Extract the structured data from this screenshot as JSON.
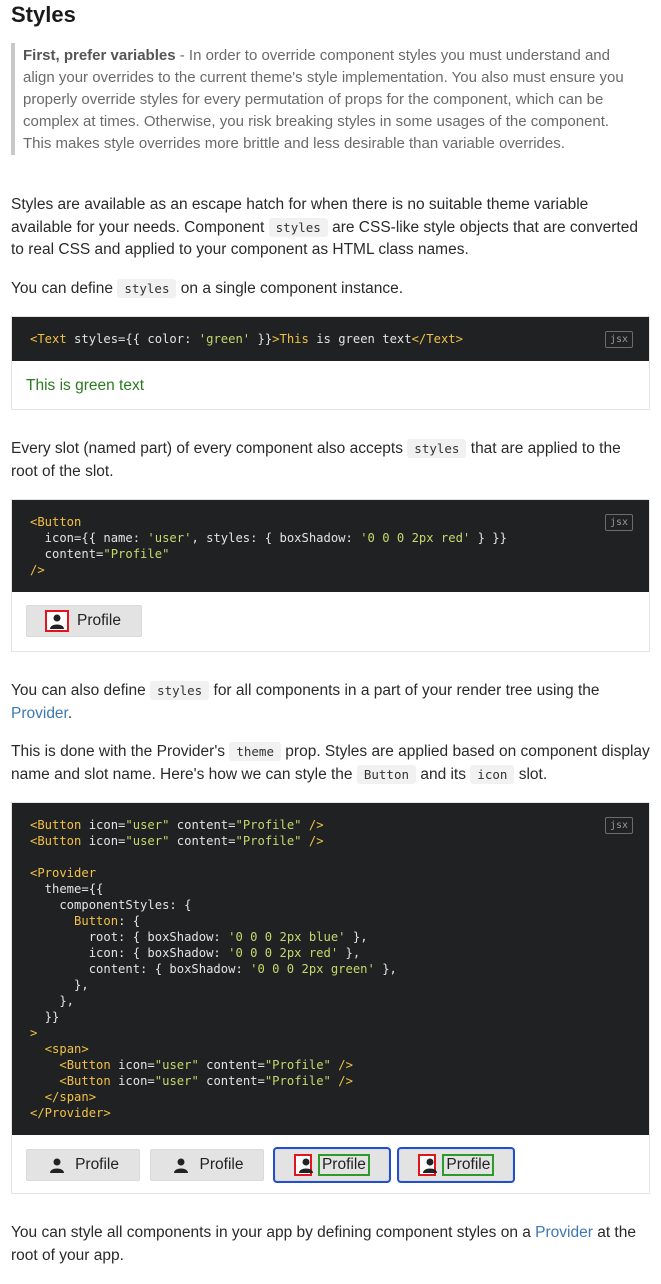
{
  "heading": "Styles",
  "callout": {
    "bold": "First, prefer variables",
    "text": " - In order to override component styles you must understand and align your overrides to the current theme's style implementation. You also must ensure you properly override styles for every permutation of props for the component, which can be complex at times. Otherwise, you risk breaking styles in some usages of the component. This makes style overrides more brittle and less desirable than variable overrides."
  },
  "para1": {
    "a": "Styles are available as an escape hatch for when there is no suitable theme variable available for your needs. Component ",
    "code": "styles",
    "b": " are CSS-like style objects that are converted to real CSS and applied to your component as HTML class names."
  },
  "para2": {
    "a": "You can define ",
    "code": "styles",
    "b": " on a single component instance."
  },
  "example1": {
    "lang": "jsx",
    "preview_text": "This is green text"
  },
  "para3": {
    "a": "Every slot (named part) of every component also accepts ",
    "code": "styles",
    "b": " that are applied to the root of the slot."
  },
  "example2": {
    "lang": "jsx",
    "button_label": "Profile"
  },
  "para4": {
    "a": "You can also define ",
    "code": "styles",
    "b": " for all components in a part of your render tree using the ",
    "link": "Provider",
    "c": "."
  },
  "para5": {
    "a": "This is done with the Provider's ",
    "code1": "theme",
    "b": " prop. Styles are applied based on component display name and slot name. Here's how we can style the ",
    "code2": "Button",
    "c": " and its ",
    "code3": "icon",
    "d": " slot."
  },
  "example3": {
    "lang": "jsx",
    "buttons": [
      "Profile",
      "Profile",
      "Profile",
      "Profile"
    ]
  },
  "para6": {
    "a": "You can style all components in your app by defining component styles on a ",
    "link": "Provider",
    "b": " at the root of your app."
  },
  "colors": {
    "accent_link": "#3c78b4",
    "code_bg": "#1f2122",
    "green": "#2a7a1e",
    "red": "#e0161c",
    "blue": "#2050d0"
  },
  "icons": {
    "button_icon": "user-icon"
  }
}
